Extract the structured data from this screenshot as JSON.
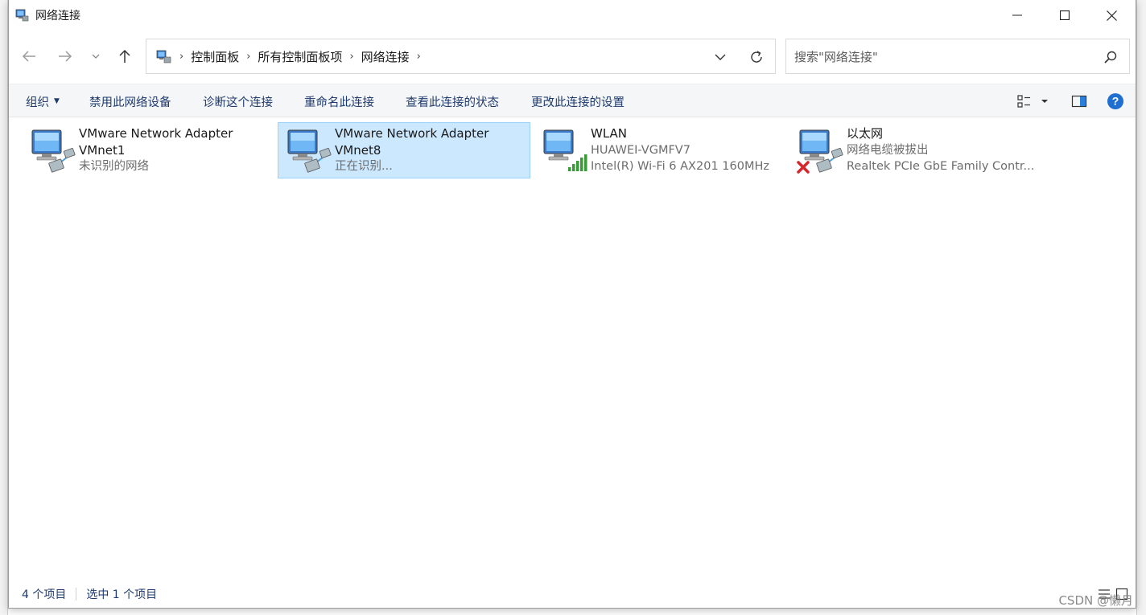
{
  "window": {
    "title": "网络连接"
  },
  "address": {
    "crumbs": [
      "控制面板",
      "所有控制面板项",
      "网络连接"
    ]
  },
  "search": {
    "placeholder": "搜索\"网络连接\""
  },
  "commands": {
    "organize": "组织",
    "disable": "禁用此网络设备",
    "diagnose": "诊断这个连接",
    "rename": "重命名此连接",
    "status": "查看此连接的状态",
    "settings": "更改此连接的设置"
  },
  "connections": [
    {
      "name": "VMware Network Adapter VMnet1",
      "line1": "未识别的网络",
      "line2": "",
      "kind": "adapter",
      "selected": false
    },
    {
      "name": "VMware Network Adapter VMnet8",
      "line1": "正在识别...",
      "line2": "",
      "kind": "adapter",
      "selected": true
    },
    {
      "name": "WLAN",
      "line1": "HUAWEI-VGMFV7",
      "line2": "Intel(R) Wi-Fi 6 AX201 160MHz",
      "kind": "wifi",
      "selected": false
    },
    {
      "name": "以太网",
      "line1": "网络电缆被拔出",
      "line2": "Realtek PCIe GbE Family Contr...",
      "kind": "ethernet-unplugged",
      "selected": false
    }
  ],
  "status": {
    "count": "4 个项目",
    "selected": "选中 1 个项目"
  },
  "watermark": "CSDN @懒月",
  "colors": {
    "selection_bg": "#cce8ff",
    "selection_border": "#99d1ff",
    "link": "#1e3a6e",
    "help": "#1f6fd1",
    "signal": "#3a9a3a",
    "error": "#d6262b"
  }
}
